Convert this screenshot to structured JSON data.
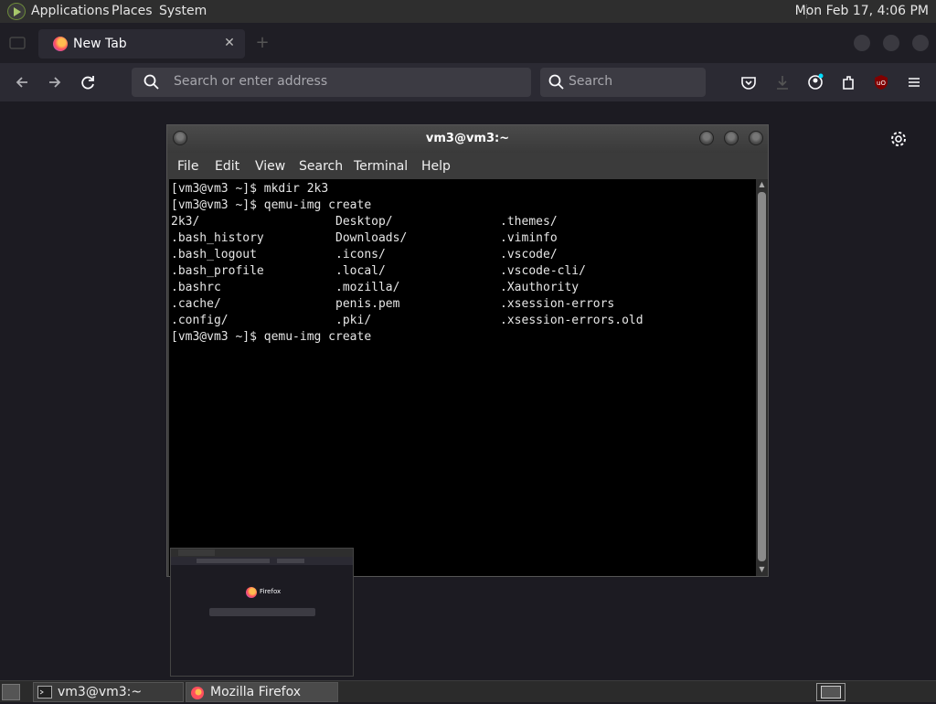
{
  "top_panel": {
    "menus": [
      "Applications",
      "Places",
      "System"
    ],
    "clock": "Mon Feb 17,  4:06 PM"
  },
  "firefox": {
    "tab_title": "New Tab",
    "url_placeholder": "Search or enter address",
    "search_placeholder": "Search",
    "taskbar_label": "Mozilla Firefox"
  },
  "terminal": {
    "title": "vm3@vm3:~",
    "menus": [
      "File",
      "Edit",
      "View",
      "Search",
      "Terminal",
      "Help"
    ],
    "lines": [
      "[vm3@vm3 ~]$ mkdir 2k3",
      "[vm3@vm3 ~]$ qemu-img create",
      "2k3/                   Desktop/               .themes/",
      ".bash_history          Downloads/             .viminfo",
      ".bash_logout           .icons/                .vscode/",
      ".bash_profile          .local/                .vscode-cli/",
      ".bashrc                .mozilla/              .Xauthority",
      ".cache/                penis.pem              .xsession-errors",
      ".config/               .pki/                  .xsession-errors.old",
      "[vm3@vm3 ~]$ qemu-img create"
    ],
    "taskbar_label": "vm3@vm3:~"
  },
  "preview": {
    "brand": "Firefox"
  }
}
